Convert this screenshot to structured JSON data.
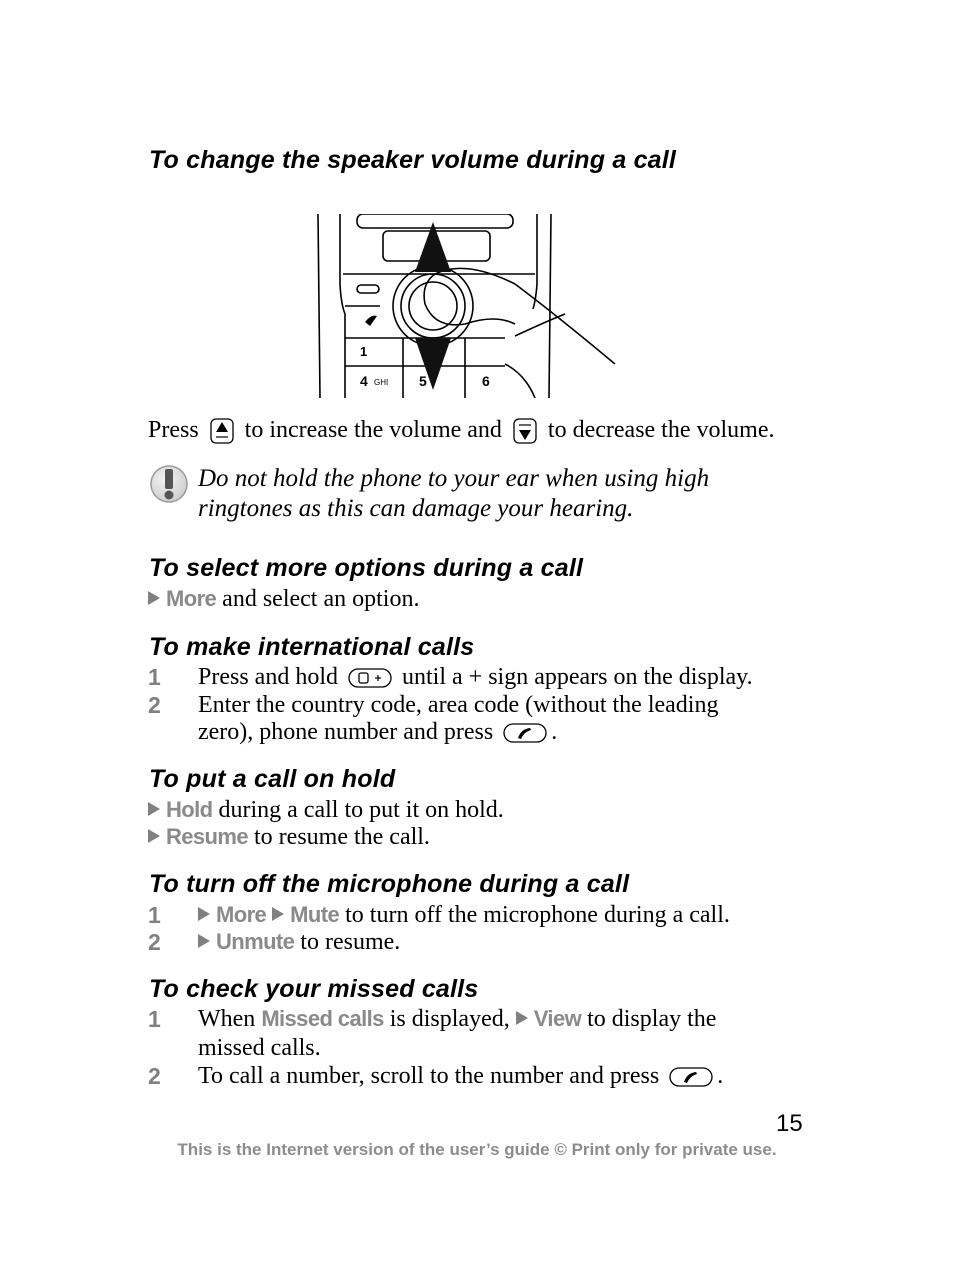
{
  "sections": [
    {
      "heading": "To change the speaker volume during a call",
      "image": "phone-volume-illustration",
      "instruction": {
        "pre": "Press",
        "mid": "to increase the volume and",
        "post": "to decrease the volume.",
        "icons": [
          "volume-up-key-icon",
          "volume-down-key-icon"
        ]
      },
      "warning": {
        "icon": "exclamation-warning-icon",
        "lines": [
          "Do not hold the phone to your ear when using high",
          "ringtones as this can damage your hearing."
        ]
      }
    },
    {
      "heading": "To select more options during a call",
      "lines": [
        {
          "menu": "More",
          "text": "and select an option."
        }
      ]
    },
    {
      "heading": "To make international calls",
      "steps": [
        {
          "num": "1",
          "pre": "Press and hold",
          "key": "zero-plus-key-icon",
          "post": "until a + sign appears on the display."
        },
        {
          "num": "2",
          "line1": "Enter the country code, area code (without the leading",
          "line2_pre": "zero), phone number and press",
          "key": "call-key-icon",
          "line2_post": "."
        }
      ]
    },
    {
      "heading": "To put a call on hold",
      "lines": [
        {
          "menu": "Hold",
          "text": "during a call to put it on hold."
        },
        {
          "menu": "Resume",
          "text": "to resume the call."
        }
      ]
    },
    {
      "heading": "To turn off the microphone during a call",
      "steps": [
        {
          "num": "1",
          "menu1": "More",
          "menu2": "Mute",
          "text": "to turn off the microphone during a call."
        },
        {
          "num": "2",
          "menu1": "Unmute",
          "text": "to resume."
        }
      ]
    },
    {
      "heading": "To check your missed calls",
      "steps": [
        {
          "num": "1",
          "pre": "When",
          "menu1": "Missed calls",
          "mid": "is displayed,",
          "menu2": "View",
          "post": "to display the",
          "line2": "missed calls."
        },
        {
          "num": "2",
          "pre": "To call a number, scroll to the number and press",
          "key": "call-key-icon",
          "post": "."
        }
      ]
    }
  ],
  "page_number": "15",
  "footer": "This is the Internet version of the user’s guide © Print only for private use.",
  "colors": {
    "menu_text": "#8a8a8a",
    "step_number": "#808080",
    "footer": "#8c8c8c"
  }
}
